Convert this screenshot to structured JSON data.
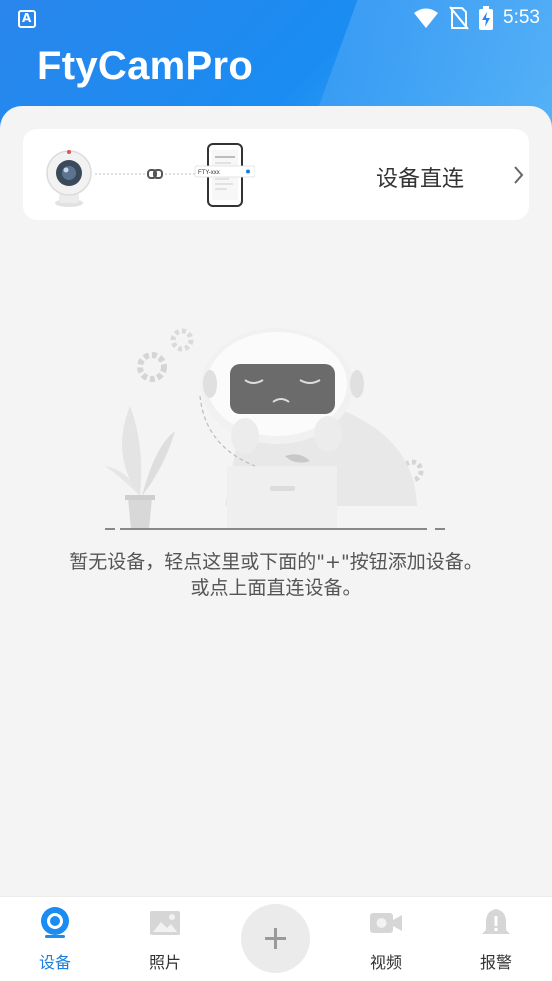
{
  "status_bar": {
    "time": "5:53",
    "icons": [
      "app-notification-icon",
      "wifi-icon",
      "no-sim-icon",
      "battery-charging-icon"
    ]
  },
  "app": {
    "title": "FtyCamPro"
  },
  "direct_connect_card": {
    "label": "设备直连",
    "phone_screen_text": "FTY-xxx",
    "icons": [
      "camera-icon",
      "link-icon",
      "phone-icon",
      "chevron-right-icon"
    ]
  },
  "empty_state": {
    "line1": "暂无设备，轻点这里或下面的\"+\"按钮添加设备。",
    "line2": "或点上面直连设备。"
  },
  "tab_bar": {
    "tabs": [
      {
        "label": "设备",
        "icon": "device-camera-icon",
        "active": true
      },
      {
        "label": "照片",
        "icon": "photo-icon",
        "active": false
      },
      {
        "label": "",
        "icon": "plus-icon",
        "active": false
      },
      {
        "label": "视频",
        "icon": "video-icon",
        "active": false
      },
      {
        "label": "报警",
        "icon": "alarm-bell-icon",
        "active": false
      }
    ]
  },
  "colors": {
    "header_blue": "#1a8cf2",
    "active_tab": "#1a7fe0",
    "background": "#f4f4f4"
  }
}
